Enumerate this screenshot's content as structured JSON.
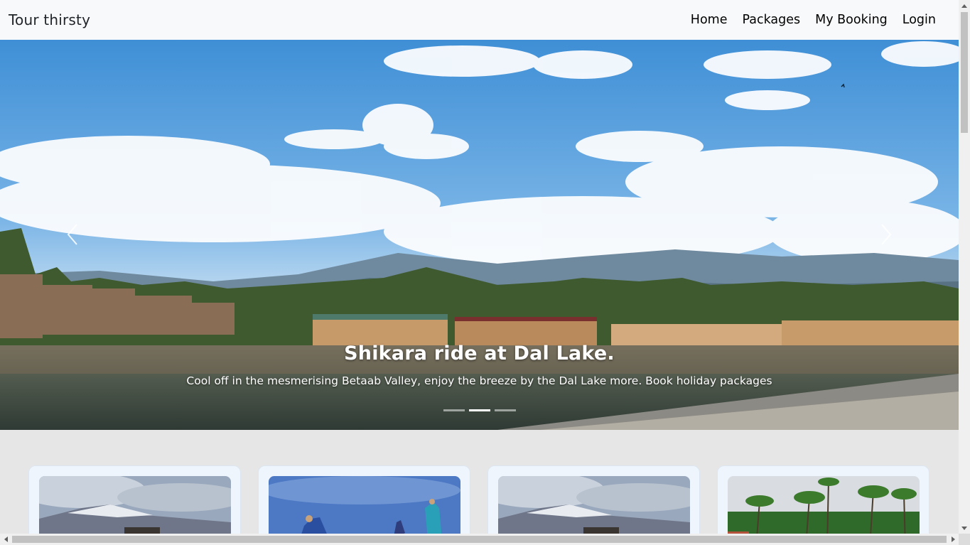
{
  "navbar": {
    "brand": "Tour thirsty",
    "links": [
      "Home",
      "Packages",
      "My Booking",
      "Login"
    ]
  },
  "carousel": {
    "caption_title": "Shikara ride at Dal Lake.",
    "caption_text": "Cool off in the mesmerising Betaab Valley, enjoy the breeze by the Dal Lake more. Book holiday packages",
    "active_slide": 2,
    "slide_count": 3
  },
  "cards": [
    {
      "image": "snowy-mountain-photo"
    },
    {
      "image": "group-jumping-photo"
    },
    {
      "image": "snowy-mountain-photo"
    },
    {
      "image": "palm-trees-photo"
    }
  ],
  "colors": {
    "navbar_bg": "#f8f9fa",
    "page_bg": "#e6e6e6",
    "card_bg": "#eef5fd"
  }
}
